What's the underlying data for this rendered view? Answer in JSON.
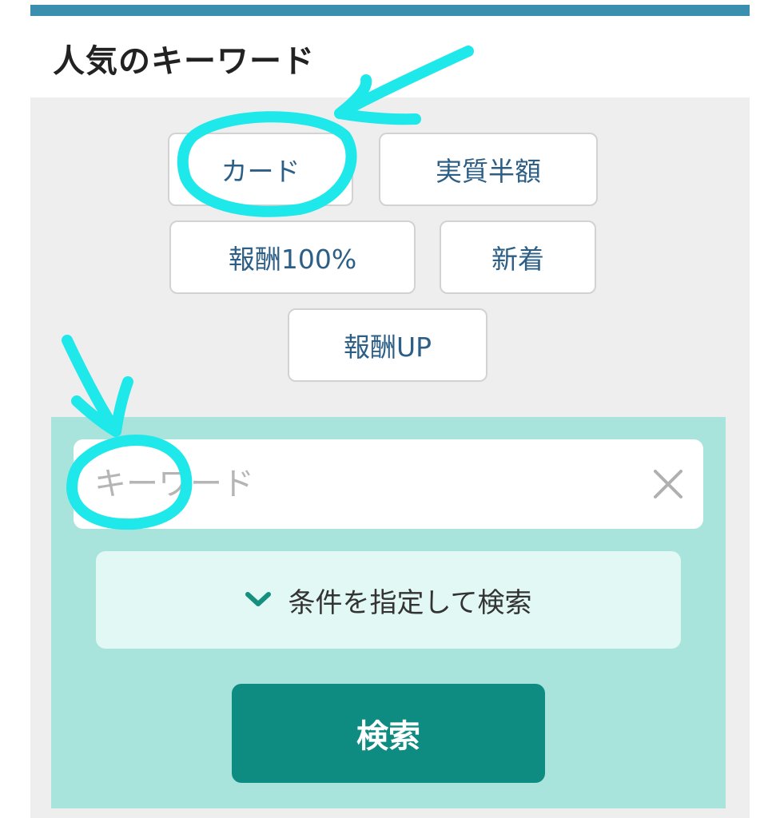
{
  "section": {
    "title": "人気のキーワード"
  },
  "keywords": [
    "カード",
    "実質半額",
    "報酬100%",
    "新着",
    "報酬UP"
  ],
  "search": {
    "placeholder": "キーワード",
    "value": "",
    "clear_icon": "close-icon",
    "conditions_label": "条件を指定して検索",
    "conditions_icon": "chevron-down-icon",
    "button_label": "検索"
  },
  "colors": {
    "top_bar": "#3b8fae",
    "search_area": "#a8e3dc",
    "search_button": "#0e8c82",
    "keyword_text": "#2d5f86",
    "annotation": "#1ee8ea"
  }
}
